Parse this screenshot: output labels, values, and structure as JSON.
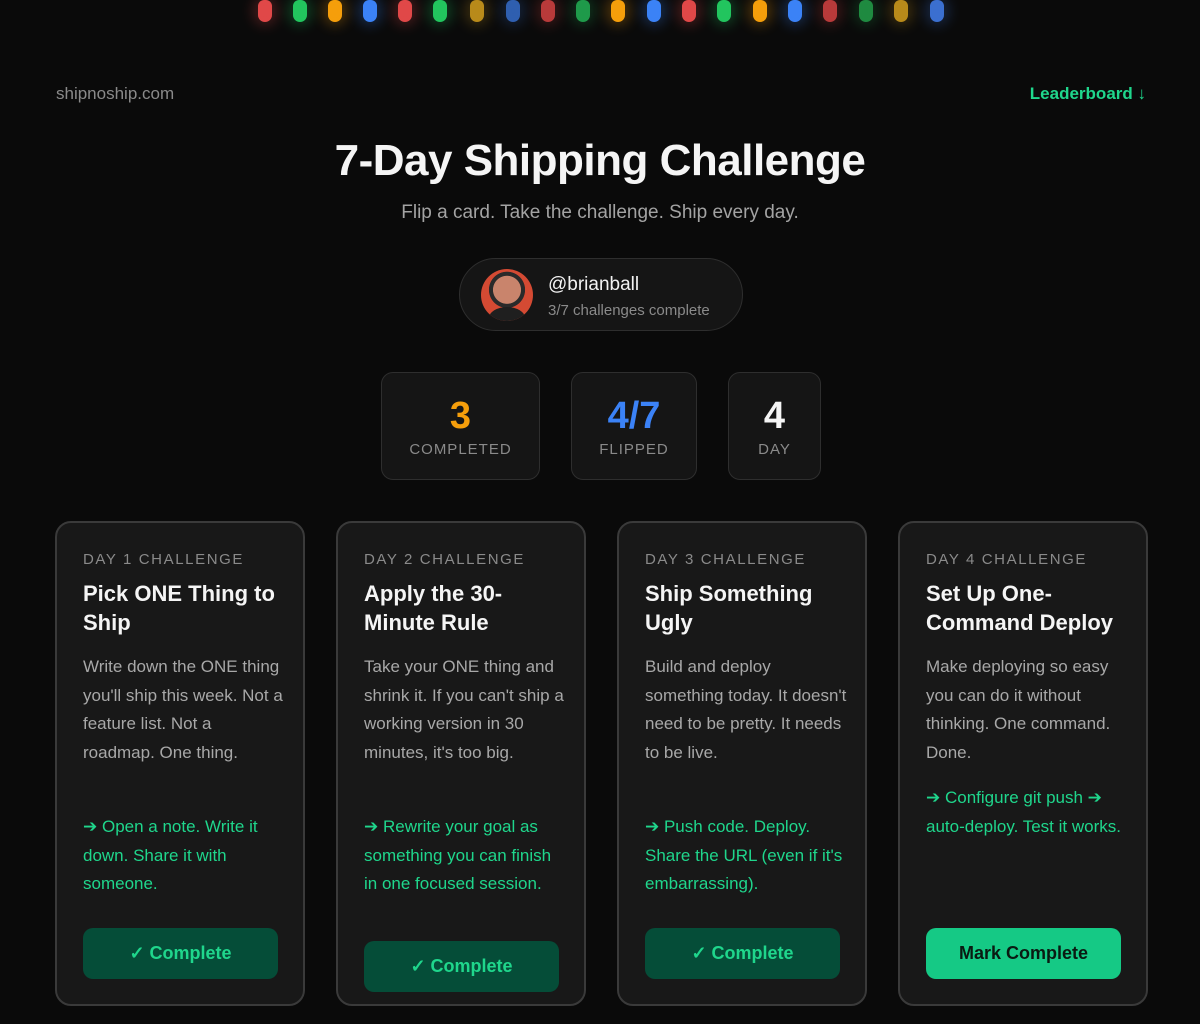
{
  "colors": {
    "background": "#0a0a0a",
    "accent_green": "#1fd68c",
    "completed_orange": "#f59e0b",
    "flipped_blue": "#3b82f6",
    "bulbs": [
      "#e04848",
      "#22c55e",
      "#f59e0b",
      "#3b82f6",
      "#e04848",
      "#22c55e",
      "#b88a1a",
      "#2f5fb0",
      "#b83a3a",
      "#1f9a4a",
      "#f59e0b",
      "#3b82f6",
      "#e04848",
      "#22c55e",
      "#f59e0b",
      "#3b82f6",
      "#b83a3a",
      "#1f8a40",
      "#b88a1a",
      "#3b6fd0"
    ]
  },
  "header": {
    "site": "shipnoship.com",
    "leaderboard_link": "Leaderboard ↓"
  },
  "title": "7-Day Shipping Challenge",
  "subtitle": "Flip a card. Take the challenge. Ship every day.",
  "user": {
    "handle": "@brianball",
    "progress": "3/7 challenges complete",
    "avatar_icon": "user-photo"
  },
  "stats": [
    {
      "value": "3",
      "label": "COMPLETED"
    },
    {
      "value": "4/7",
      "label": "FLIPPED"
    },
    {
      "value": "4",
      "label": "DAY"
    }
  ],
  "cards": [
    {
      "day": "DAY 1 CHALLENGE",
      "title": "Pick ONE Thing to Ship",
      "description": "Write down the ONE thing you'll ship this week. Not a feature list. Not a roadmap. One thing.",
      "action": "➔ Open a note. Write it down. Share it with someone.",
      "button": "✓ Complete",
      "completed": true
    },
    {
      "day": "DAY 2 CHALLENGE",
      "title": "Apply the 30-Minute Rule",
      "description": "Take your ONE thing and shrink it. If you can't ship a working version in 30 minutes, it's too big.",
      "action": "➔ Rewrite your goal as something you can finish in one focused session.",
      "button": "✓ Complete",
      "completed": true
    },
    {
      "day": "DAY 3 CHALLENGE",
      "title": "Ship Something Ugly",
      "description": "Build and deploy something today. It doesn't need to be pretty. It needs to be live.",
      "action": "➔ Push code. Deploy. Share the URL (even if it's embarrassing).",
      "button": "✓ Complete",
      "completed": true
    },
    {
      "day": "DAY 4 CHALLENGE",
      "title": "Set Up One-Command Deploy",
      "description": "Make deploying so easy you can do it without thinking. One command. Done.",
      "action": "➔ Configure git push ➔ auto-deploy. Test it works.",
      "button": "Mark Complete",
      "completed": false
    }
  ]
}
